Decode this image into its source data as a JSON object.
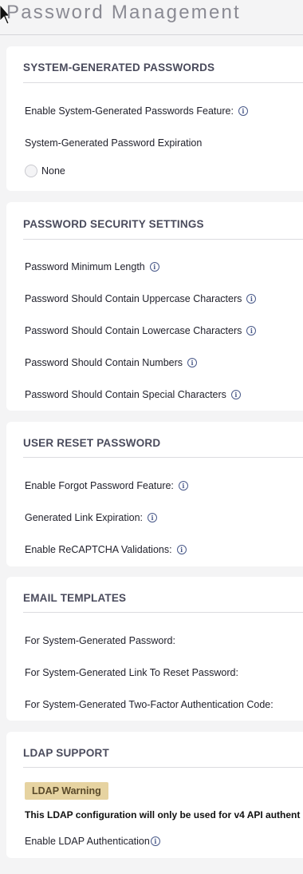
{
  "page": {
    "title": "Password Management"
  },
  "system_generated": {
    "title": "SYSTEM-GENERATED PASSWORDS",
    "enable_label": "Enable System-Generated Passwords Feature:",
    "expiration_label": "System-Generated Password Expiration",
    "none_label": "None"
  },
  "security": {
    "title": "PASSWORD SECURITY SETTINGS",
    "items": [
      "Password Minimum Length",
      "Password Should Contain Uppercase Characters",
      "Password Should Contain Lowercase Characters",
      "Password Should Contain Numbers",
      "Password Should Contain Special Characters"
    ]
  },
  "reset": {
    "title": "USER RESET PASSWORD",
    "items": [
      "Enable Forgot Password Feature:",
      "Generated Link Expiration:",
      "Enable ReCAPTCHA Validations:"
    ]
  },
  "email": {
    "title": "EMAIL TEMPLATES",
    "items": [
      "For System-Generated Password:",
      "For System-Generated Link To Reset Password:",
      "For System-Generated Two-Factor Authentication Code:"
    ]
  },
  "ldap": {
    "title": "LDAP SUPPORT",
    "badge": "LDAP Warning",
    "warning": "This LDAP configuration will only be used for v4 API authent",
    "enable_label": "Enable LDAP Authentication"
  },
  "icons": {
    "info": "info-icon",
    "cursor": "mouse-pointer-icon"
  }
}
